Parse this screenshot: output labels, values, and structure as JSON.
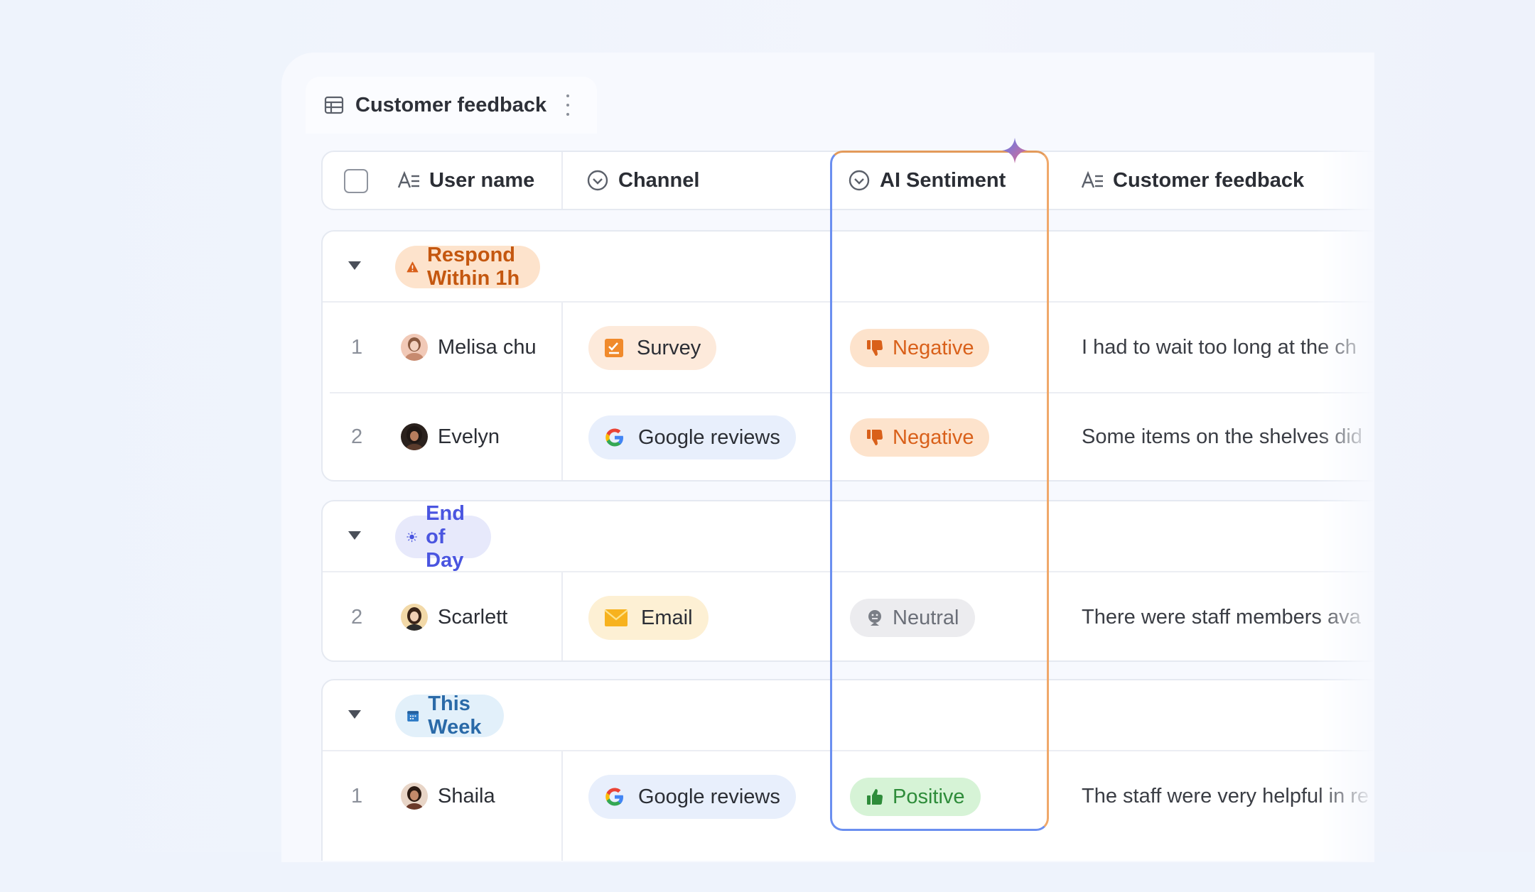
{
  "tab": {
    "title": "Customer feedback"
  },
  "columns": {
    "user_name": "User name",
    "channel": "Channel",
    "ai_sentiment": "AI Sentiment",
    "customer_feedback": "Customer feedback"
  },
  "groups": [
    {
      "label": "Respond Within 1h",
      "icon": "warning-icon",
      "color": "#c4570f",
      "rows": [
        {
          "num": "1",
          "user": "Melisa chu",
          "channel": "Survey",
          "channel_icon": "survey-icon",
          "sentiment": "Negative",
          "feedback": "I had to wait too long at the ch"
        },
        {
          "num": "2",
          "user": "Evelyn",
          "channel": "Google reviews",
          "channel_icon": "google-icon",
          "sentiment": "Negative",
          "feedback": "Some items on the shelves did"
        }
      ]
    },
    {
      "label": "End of Day",
      "icon": "sun-icon",
      "color": "#4a55e0",
      "rows": [
        {
          "num": "2",
          "user": "Scarlett",
          "channel": "Email",
          "channel_icon": "envelope-icon",
          "sentiment": "Neutral",
          "feedback": "There were staff members ava"
        }
      ]
    },
    {
      "label": "This Week",
      "icon": "calendar-icon",
      "color": "#2a6aa8",
      "rows": [
        {
          "num": "1",
          "user": "Shaila",
          "channel": "Google reviews",
          "channel_icon": "google-icon",
          "sentiment": "Positive",
          "feedback": "The staff were very helpful in re"
        }
      ]
    }
  ],
  "colors": {
    "negative_bg": "#fde3cc",
    "negative_text": "#d9601a",
    "neutral_bg": "#ececef",
    "neutral_text": "#6b6f78",
    "positive_bg": "#d6f3d6",
    "positive_text": "#2e8c3a",
    "ai_border": "#6b8ff0"
  }
}
